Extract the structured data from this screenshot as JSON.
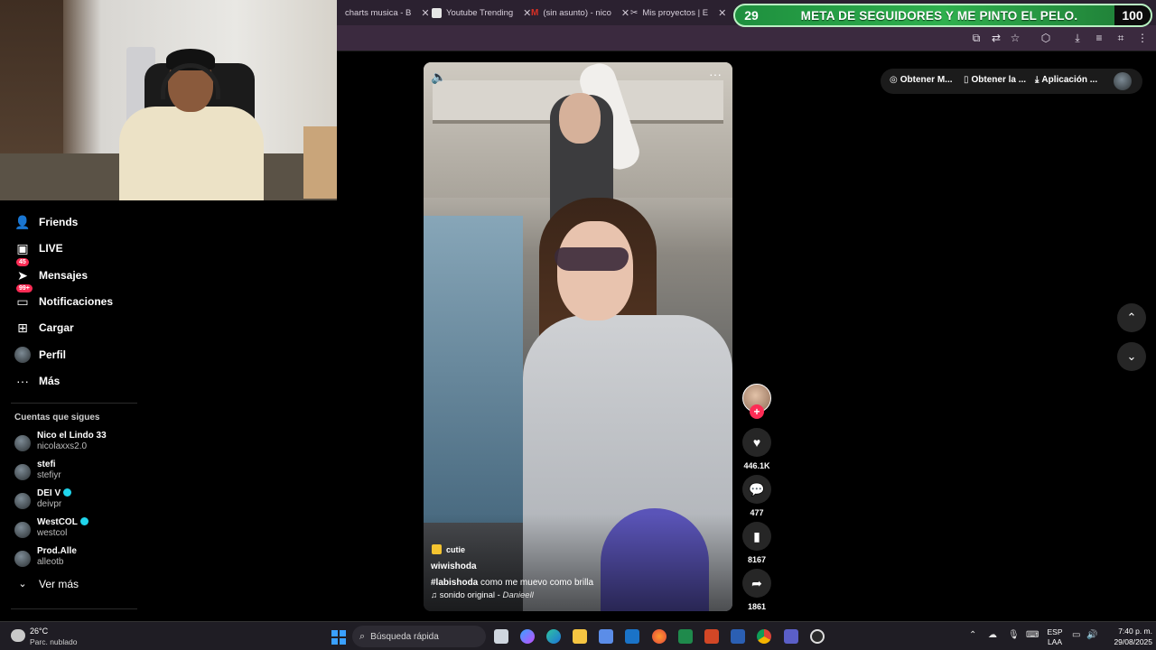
{
  "browser": {
    "tabs": [
      {
        "title": "charts musica - B",
        "icon": "charts-favicon",
        "color": "#4a4a7a"
      },
      {
        "title": "Youtube Trending",
        "icon": "youtube-favicon",
        "color": "#e6e6e6"
      },
      {
        "title": "(sin asunto) - nico",
        "icon": "gmail-favicon",
        "color": "#d93025"
      },
      {
        "title": "Mis proyectos | E",
        "icon": "capcut-favicon",
        "color": "#ffffff"
      }
    ]
  },
  "stream_overlay": {
    "current_count": "29",
    "goal_text": "META DE SEGUIDORES Y ME PINTO EL PELO.",
    "goal_target": "100"
  },
  "sidebar": {
    "nav": [
      {
        "label": "Friends",
        "icon": "friends-icon",
        "glyph": "👥"
      },
      {
        "label": "LIVE",
        "icon": "live-icon",
        "glyph": "▣"
      },
      {
        "label": "Mensajes",
        "icon": "messages-icon",
        "glyph": "➤",
        "badge": "45"
      },
      {
        "label": "Notificaciones",
        "icon": "notifications-icon",
        "glyph": "▭",
        "badge": "99+"
      },
      {
        "label": "Cargar",
        "icon": "upload-icon",
        "glyph": "⊞"
      },
      {
        "label": "Perfil",
        "icon": "profile-avatar",
        "glyph": ""
      },
      {
        "label": "Más",
        "icon": "more-icon",
        "glyph": "···"
      }
    ],
    "following_title": "Cuentas que sigues",
    "following": [
      {
        "name": "Nico el Lindo 33",
        "handle": "nicolaxxs2.0",
        "verified": false
      },
      {
        "name": "stefi",
        "handle": "stefiyr",
        "verified": false
      },
      {
        "name": "DEI V",
        "handle": "deivpr",
        "verified": true
      },
      {
        "name": "WestCOL",
        "handle": "westcol",
        "verified": true
      },
      {
        "name": "Prod.Alle",
        "handle": "alleotb",
        "verified": false
      }
    ],
    "see_more": "Ver más"
  },
  "top_actions": {
    "get_coins": "Obtener M...",
    "get_app": "Obtener la ...",
    "desktop_app": "Aplicación ..."
  },
  "video": {
    "tag": "cutie",
    "username": "wiwishoda",
    "hashtag": "#labishoda",
    "description": "como me muevo como brilla",
    "sound_label": "sonido original",
    "sound_author": "Danieell",
    "sound_separator": " - "
  },
  "actions": {
    "likes": "446.1K",
    "comments": "477",
    "saves": "8167",
    "shares": "1861"
  },
  "taskbar": {
    "temperature": "26°C",
    "weather": "Parc. nublado",
    "search_placeholder": "Búsqueda rápida",
    "language_top": "ESP",
    "language_bottom": "LAA",
    "time": "7:40 p. m.",
    "date": "29/08/2025"
  },
  "colors": {
    "accent": "#fe2c55",
    "goal_green": "#2fb04e",
    "verified": "#20d5ec"
  }
}
